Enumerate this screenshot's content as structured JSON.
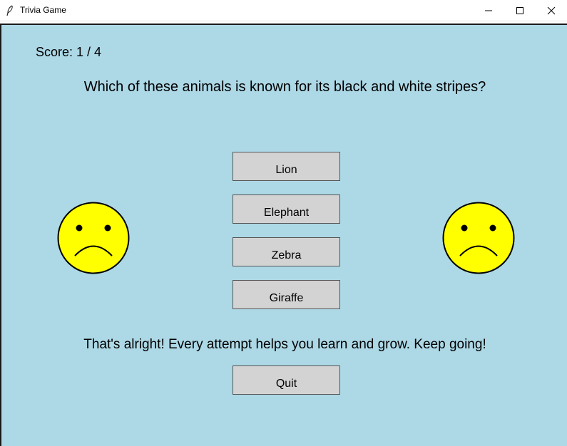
{
  "window": {
    "title": "Trivia Game"
  },
  "game": {
    "score_text": "Score: 1 / 4",
    "question": "Which of these animals is known for its black and white stripes?",
    "answers": [
      {
        "label": "Lion"
      },
      {
        "label": "Elephant"
      },
      {
        "label": "Zebra"
      },
      {
        "label": "Giraffe"
      }
    ],
    "feedback": "That's alright! Every attempt helps you learn and grow. Keep going!",
    "quit_label": "Quit"
  },
  "colors": {
    "background": "#add8e6",
    "button": "#d3d3d3",
    "face": "#ffff00"
  },
  "icons": {
    "app": "feather-icon",
    "faces": "sad-face-icon"
  }
}
